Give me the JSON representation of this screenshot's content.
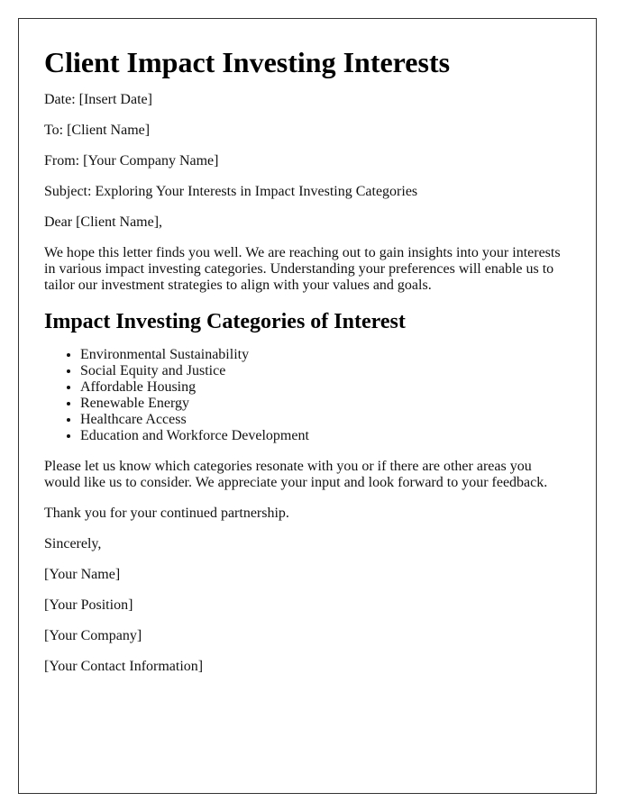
{
  "document": {
    "title": "Client Impact Investing Interests",
    "header_fields": {
      "date": "Date: [Insert Date]",
      "to": "To: [Client Name]",
      "from": "From: [Your Company Name]",
      "subject": "Subject: Exploring Your Interests in Impact Investing Categories"
    },
    "salutation": "Dear [Client Name],",
    "intro_paragraph": "We hope this letter finds you well. We are reaching out to gain insights into your interests in various impact investing categories. Understanding your preferences will enable us to tailor our investment strategies to align with your values and goals.",
    "section_heading": "Impact Investing Categories of Interest",
    "categories": [
      "Environmental Sustainability",
      "Social Equity and Justice",
      "Affordable Housing",
      "Renewable Energy",
      "Healthcare Access",
      "Education and Workforce Development"
    ],
    "request_paragraph": "Please let us know which categories resonate with you or if there are other areas you would like us to consider. We appreciate your input and look forward to your feedback.",
    "thanks": "Thank you for your continued partnership.",
    "closing": "Sincerely,",
    "signature": {
      "name": "[Your Name]",
      "position": "[Your Position]",
      "company": "[Your Company]",
      "contact": "[Your Contact Information]"
    }
  }
}
